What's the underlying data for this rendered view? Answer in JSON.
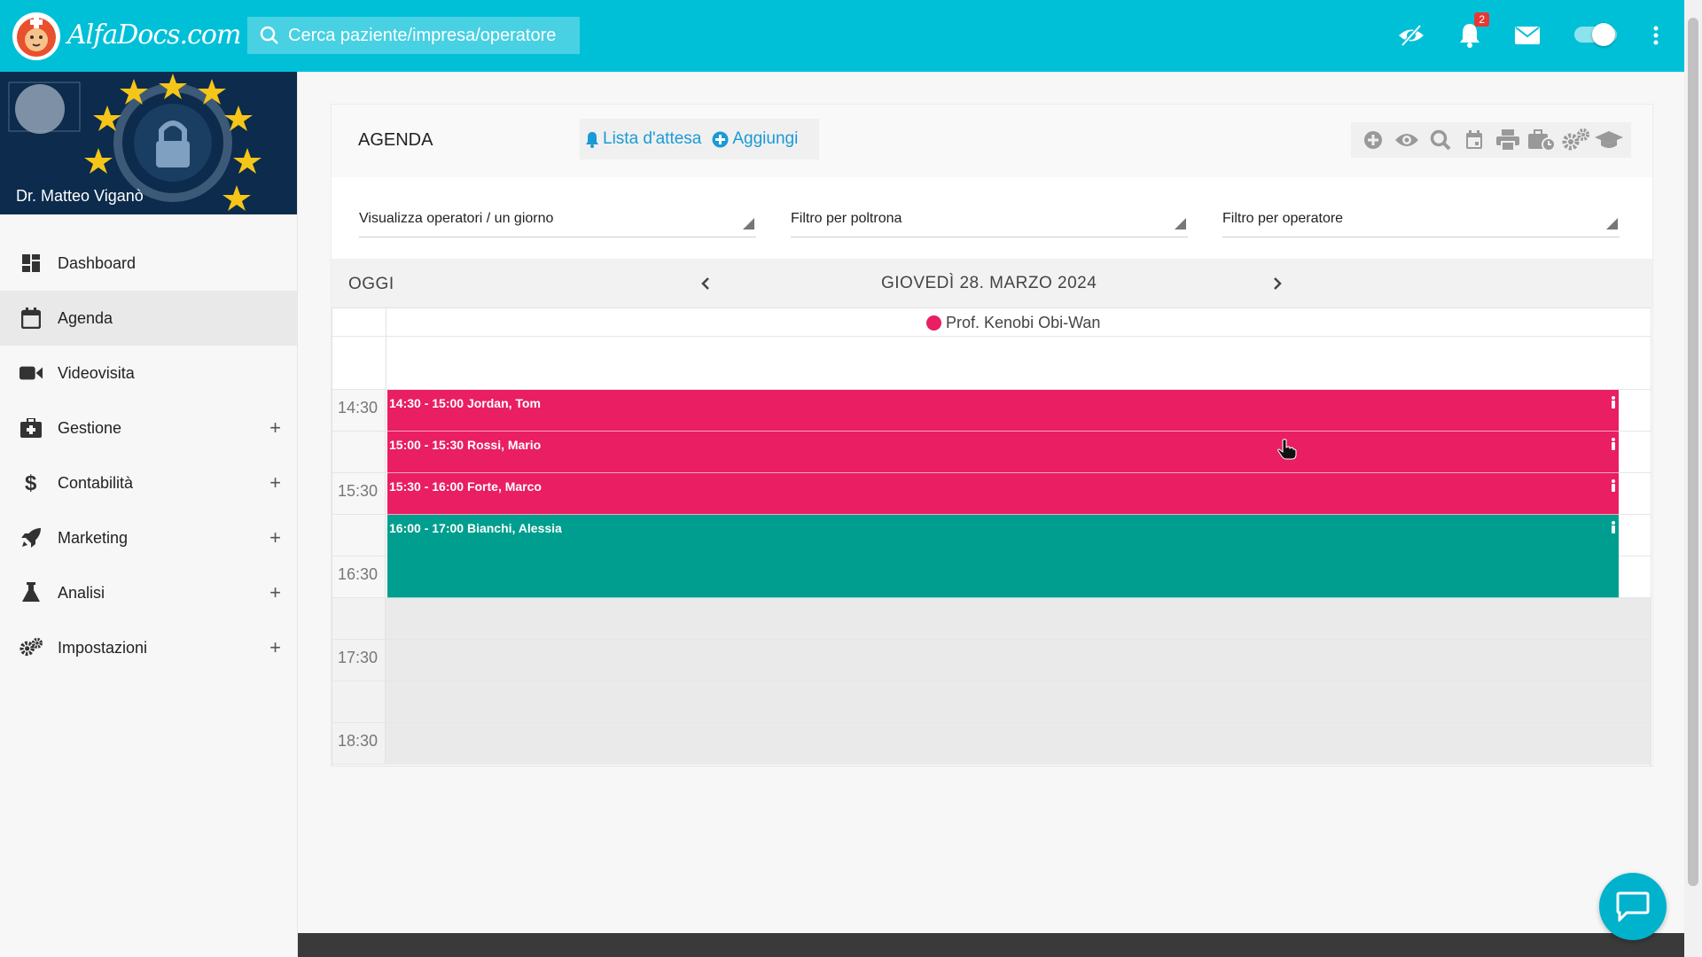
{
  "header": {
    "logo_text": "AlfaDocs.com",
    "search_placeholder": "Cerca paziente/impresa/operatore",
    "notification_count": "2"
  },
  "sidebar": {
    "user_name": "Dr. Matteo Viganò",
    "items": [
      {
        "label": "Dashboard",
        "icon": "dashboard-icon",
        "expandable": false,
        "active": false
      },
      {
        "label": "Agenda",
        "icon": "calendar-icon",
        "expandable": false,
        "active": true
      },
      {
        "label": "Videovisita",
        "icon": "video-camera-icon",
        "expandable": false,
        "active": false
      },
      {
        "label": "Gestione",
        "icon": "medical-kit-icon",
        "expandable": true,
        "active": false
      },
      {
        "label": "Contabilità",
        "icon": "dollar-icon",
        "expandable": true,
        "active": false
      },
      {
        "label": "Marketing",
        "icon": "rocket-icon",
        "expandable": true,
        "active": false
      },
      {
        "label": "Analisi",
        "icon": "flask-icon",
        "expandable": true,
        "active": false
      },
      {
        "label": "Impostazioni",
        "icon": "gears-icon",
        "expandable": true,
        "active": false
      }
    ],
    "expand_symbol": "+"
  },
  "agenda": {
    "title": "AGENDA",
    "waitlist_label": "Lista d'attesa",
    "add_label": "Aggiungi",
    "tools": [
      "add-circle-icon",
      "eye-icon",
      "search-icon",
      "calendar-day-icon",
      "print-icon",
      "briefcase-clock-icon",
      "gears-icon",
      "graduation-cap-icon"
    ],
    "filters": {
      "view": "Visualizza operatori / un giorno",
      "chair": "Filtro per poltrona",
      "operator": "Filtro per operatore"
    },
    "today_label": "OGGI",
    "date_label": "GIOVEDÌ 28. MARZO 2024",
    "operator_name": "Prof. Kenobi Obi-Wan",
    "operator_color": "#e91e63",
    "time_labels": [
      "14:30",
      "15:30",
      "16:30",
      "17:30",
      "18:30"
    ],
    "appointments": [
      {
        "time": "14:30 - 15:00",
        "patient": "Jordan, Tom",
        "color": "#e91e63"
      },
      {
        "time": "15:00 - 15:30",
        "patient": "Rossi, Mario",
        "color": "#e91e63"
      },
      {
        "time": "15:30 - 16:00",
        "patient": "Forte, Marco",
        "color": "#e91e63"
      },
      {
        "time": "16:00 - 17:00",
        "patient": "Bianchi, Alessia",
        "color": "#009e8e"
      }
    ]
  },
  "colors": {
    "topbar": "#00c0d8",
    "link": "#1a9ad6"
  }
}
